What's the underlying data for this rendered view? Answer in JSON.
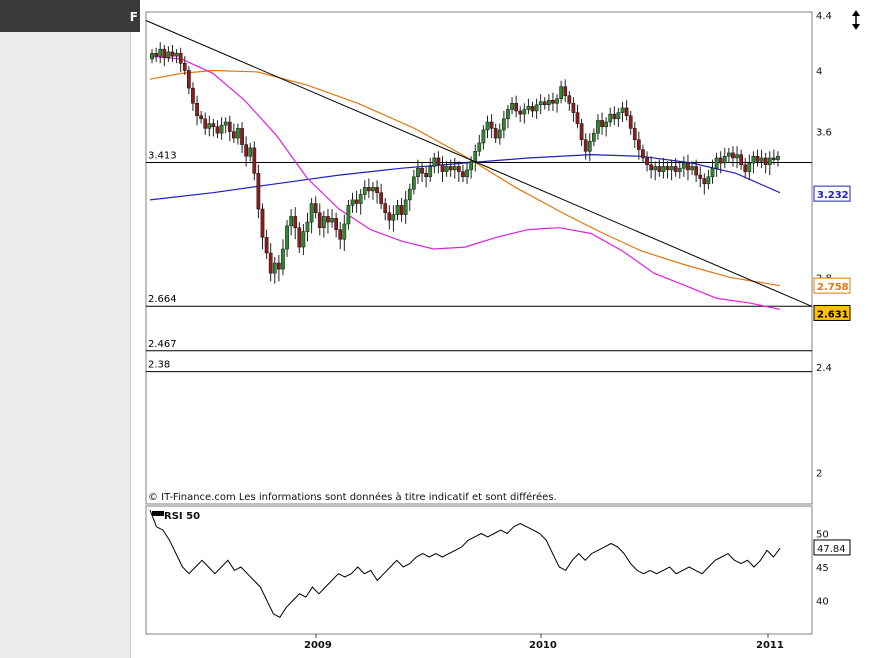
{
  "topbar": {
    "letter": "F"
  },
  "copyright": "© IT-Finance.com Les informations sont données à titre indicatif et sont différées.",
  "rsi_label": "RSI 50",
  "colors": {
    "ma_short": "#e020e0",
    "ma_mid": "#e07810",
    "ma_long": "#2020c0",
    "trend": "#000000",
    "badge_price": "#ffc000",
    "candle_up": "#2f8a2f",
    "candle_down": "#8a1e1e"
  },
  "chart_data": [
    {
      "type": "candlestick",
      "x_ticks": [
        "2009",
        "2010",
        "2011"
      ],
      "y_ticks": [
        "4.4",
        "4",
        "3.6",
        "2.8",
        "2.4",
        "2"
      ],
      "ylim": [
        2.0,
        4.4
      ],
      "scale": "log",
      "start": {
        "month": "2008-03",
        "price": 4.08
      },
      "weekly_moves": [
        0.04,
        -0.02,
        0.05,
        -0.06,
        0.04,
        -0.03,
        0.02,
        -0.07,
        -0.05,
        -0.12,
        -0.1,
        -0.08,
        -0.02,
        -0.06,
        0.03,
        -0.02,
        -0.04,
        0.05,
        0.02,
        -0.06,
        -0.04,
        0.06,
        -0.1,
        -0.07,
        0.05,
        -0.15,
        -0.2,
        -0.15,
        -0.08,
        -0.1,
        0.05,
        -0.03,
        0.1,
        0.12,
        0.05,
        -0.06,
        -0.1,
        0.08,
        0.05,
        0.1,
        -0.05,
        -0.08,
        0.06,
        -0.03,
        0.02,
        -0.06,
        -0.05,
        0.08,
        0.1,
        0.03,
        -0.02,
        0.05,
        0.04,
        -0.02,
        0.02,
        -0.03,
        -0.06,
        -0.05,
        -0.04,
        0.03,
        0.05,
        -0.05,
        0.08,
        0.06,
        0.07,
        0.05,
        -0.03,
        -0.02,
        0.06,
        0.05,
        -0.04,
        -0.04,
        0.03,
        -0.02,
        0.02,
        -0.03,
        -0.03,
        0.04,
        0.05,
        0.06,
        0.05,
        0.08,
        0.05,
        -0.04,
        -0.06,
        0.05,
        0.07,
        0.06,
        0.04,
        -0.05,
        -0.02,
        0.03,
        0.02,
        -0.03,
        0.04,
        0.02,
        -0.02,
        0.03,
        -0.02,
        0.03,
        0.08,
        -0.06,
        -0.05,
        -0.06,
        -0.07,
        -0.1,
        -0.07,
        0.06,
        0.05,
        0.08,
        -0.04,
        0.03,
        0.05,
        -0.03,
        0.04,
        0.03,
        -0.05,
        -0.08,
        -0.07,
        -0.06,
        -0.05,
        -0.04,
        -0.03,
        0.02,
        -0.03,
        0.03,
        -0.02,
        0.02,
        -0.03,
        0.02,
        0.03,
        -0.04,
        0.02,
        -0.05,
        -0.02,
        -0.03,
        0.04,
        0.05,
        0.06,
        -0.03,
        0.04,
        0.02,
        -0.03,
        0.02,
        -0.06,
        -0.04,
        0.05,
        0.04,
        -0.03,
        0.02,
        -0.04,
        0.04,
        -0.01,
        0.02
      ],
      "trendline": {
        "from": {
          "month": "2008-03",
          "price": 4.36
        },
        "to": {
          "month": "2011-01",
          "price": 2.7
        }
      },
      "horizontal_levels": [
        {
          "value": 3.413,
          "label": "3.413"
        },
        {
          "value": 2.664,
          "label": "2.664"
        },
        {
          "value": 2.467,
          "label": "2.467"
        },
        {
          "value": 2.38,
          "label": "2.38"
        }
      ],
      "moving_averages": [
        {
          "color_key": "ma_long",
          "points": [
            [
              0,
              3.2
            ],
            [
              0.1,
              3.24
            ],
            [
              0.2,
              3.29
            ],
            [
              0.3,
              3.34
            ],
            [
              0.4,
              3.38
            ],
            [
              0.5,
              3.41
            ],
            [
              0.6,
              3.44
            ],
            [
              0.7,
              3.46
            ],
            [
              0.78,
              3.45
            ],
            [
              0.86,
              3.41
            ],
            [
              0.93,
              3.35
            ],
            [
              1.0,
              3.24
            ]
          ]
        },
        {
          "color_key": "ma_mid",
          "points": [
            [
              0,
              3.94
            ],
            [
              0.05,
              3.98
            ],
            [
              0.1,
              4.0
            ],
            [
              0.17,
              3.99
            ],
            [
              0.25,
              3.9
            ],
            [
              0.33,
              3.78
            ],
            [
              0.42,
              3.62
            ],
            [
              0.5,
              3.45
            ],
            [
              0.58,
              3.27
            ],
            [
              0.66,
              3.12
            ],
            [
              0.72,
              3.02
            ],
            [
              0.78,
              2.93
            ],
            [
              0.85,
              2.86
            ],
            [
              0.92,
              2.8
            ],
            [
              1.0,
              2.76
            ]
          ]
        },
        {
          "color_key": "ma_short",
          "points": [
            [
              0,
              4.1
            ],
            [
              0.05,
              4.08
            ],
            [
              0.1,
              3.98
            ],
            [
              0.15,
              3.8
            ],
            [
              0.2,
              3.58
            ],
            [
              0.25,
              3.32
            ],
            [
              0.3,
              3.15
            ],
            [
              0.35,
              3.04
            ],
            [
              0.4,
              2.98
            ],
            [
              0.45,
              2.94
            ],
            [
              0.5,
              2.95
            ],
            [
              0.55,
              3.0
            ],
            [
              0.6,
              3.04
            ],
            [
              0.65,
              3.05
            ],
            [
              0.7,
              3.02
            ],
            [
              0.75,
              2.93
            ],
            [
              0.8,
              2.82
            ],
            [
              0.85,
              2.76
            ],
            [
              0.9,
              2.7
            ],
            [
              0.95,
              2.68
            ],
            [
              1.0,
              2.65
            ]
          ]
        }
      ],
      "price_badges": [
        {
          "value": 3.232,
          "label": "3.232",
          "color_key": "ma_long",
          "fill": "#ffffff"
        },
        {
          "value": 2.758,
          "label": "2.758",
          "color_key": "ma_mid",
          "fill": "#ffffff"
        },
        {
          "value": 2.631,
          "label": "2.631",
          "color_key": "trend",
          "fill": "#ffc000"
        }
      ]
    },
    {
      "type": "line",
      "name": "RSI 50",
      "y_ticks": [
        "50",
        "45",
        "40"
      ],
      "ylim": [
        36,
        54
      ],
      "values": [
        53.5,
        51,
        50.5,
        49,
        47,
        45,
        44,
        45,
        46,
        45,
        44,
        45,
        46,
        44.5,
        45,
        44,
        43,
        42,
        40,
        38,
        37.5,
        39,
        40,
        41,
        40.5,
        42,
        41,
        42,
        43,
        44,
        43.5,
        44,
        45,
        44,
        44.5,
        43,
        44,
        45,
        46,
        45,
        45.5,
        46.5,
        47,
        46.5,
        47,
        46.5,
        47,
        47.5,
        48,
        49,
        49.5,
        50,
        49.5,
        50,
        50.5,
        50,
        51,
        51.5,
        51,
        50.5,
        50,
        49,
        47,
        45,
        44.5,
        46,
        47,
        46,
        47,
        47.5,
        48,
        48.5,
        48,
        47,
        45.5,
        44.5,
        44,
        44.5,
        44,
        44.5,
        45,
        44,
        44.5,
        45,
        44.5,
        44,
        45,
        46,
        46.5,
        47,
        46,
        45.5,
        46,
        45,
        46,
        47.5,
        46.5,
        47.8
      ]
    }
  ],
  "rsi_badge": "47.84"
}
